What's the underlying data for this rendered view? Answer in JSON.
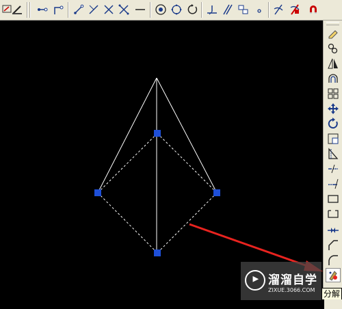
{
  "tooltip": {
    "text": "分解"
  },
  "watermark": {
    "brand": "溜溜自学",
    "url": "ZIXUE.3066.COM"
  },
  "colors": {
    "canvas_background": "#000000",
    "entity_line": "#ffffff",
    "grip": "#1e4fd8",
    "annotation_arrow": "#e8231f",
    "toolbar_bg": "#ece9d8"
  },
  "top_toolbar": {
    "icons": [
      "linetype-icon",
      "properties-brush-icon",
      "dimension-linear-icon",
      "dimension-aligned-icon",
      "dimension-arc-icon",
      "dimension-ordinate-icon",
      "dimension-radius-icon",
      "dimension-jogged-icon",
      "dimension-baseline-icon",
      "dimension-circle-icon",
      "dimension-center-icon",
      "dimension-angular-icon",
      "dimension-parallel-icon",
      "tolerance-icon",
      "center-mark-icon",
      "dimension-edit-icon",
      "dimension-update-icon",
      "snap-magnet-icon"
    ]
  },
  "right_toolbar": {
    "active_tool": "explode",
    "icons": [
      "erase-icon",
      "copy-icon",
      "mirror-icon",
      "offset-icon",
      "array-icon",
      "move-icon",
      "rotate-icon",
      "scale-icon",
      "stretch-icon",
      "trim-icon",
      "extend-icon",
      "break-at-point-icon",
      "break-icon",
      "join-icon",
      "chamfer-icon",
      "fillet-icon",
      "explode-icon"
    ]
  }
}
